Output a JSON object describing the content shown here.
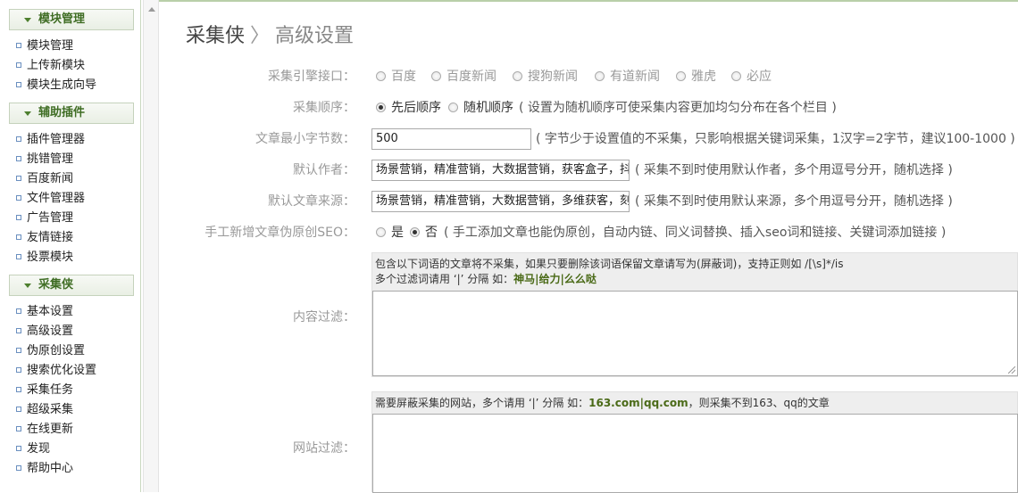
{
  "sidebar": {
    "groups": [
      {
        "title": "模块管理",
        "items": [
          "模块管理",
          "上传新模块",
          "模块生成向导"
        ]
      },
      {
        "title": "辅助插件",
        "items": [
          "插件管理器",
          "挑错管理",
          "百度新闻",
          "文件管理器",
          "广告管理",
          "友情链接",
          "投票模块"
        ]
      },
      {
        "title": "采集侠",
        "items": [
          "基本设置",
          "高级设置",
          "伪原创设置",
          "搜索优化设置",
          "采集任务",
          "超级采集",
          "在线更新",
          "发现",
          "帮助中心"
        ]
      }
    ]
  },
  "header": {
    "title": "采集侠",
    "separator": "〉",
    "subtitle": "高级设置"
  },
  "form": {
    "engine": {
      "label": "采集引擎接口：",
      "options": [
        "百度",
        "百度新闻",
        "搜狗新闻",
        "有道新闻",
        "雅虎",
        "必应"
      ]
    },
    "order": {
      "label": "采集顺序：",
      "options": [
        "先后顺序",
        "随机顺序"
      ],
      "selected": "先后顺序",
      "hint": "( 设置为随机顺序可使采集内容更加均匀分布在各个栏目 )"
    },
    "min_bytes": {
      "label": "文章最小字节数：",
      "value": "500",
      "hint": "( 字节少于设置值的不采集，只影响根据关键词采集，1汉字=2字节，建议100-1000 )"
    },
    "author": {
      "label": "默认作者：",
      "value": "场景营销，精准营销，大数据营销，获客盒子，抖",
      "hint": "( 采集不到时使用默认作者，多个用逗号分开，随机选择 )"
    },
    "source": {
      "label": "默认文章来源：",
      "value": "场景营销，精准营销，大数据营销，多维获客，刻",
      "hint": "( 采集不到时使用默认来源，多个用逗号分开，随机选择 )"
    },
    "seo": {
      "label": "手工新增文章伪原创SEO：",
      "options": [
        "是",
        "否"
      ],
      "selected": "否",
      "hint": "( 手工添加文章也能伪原创，自动内链、同义词替换、插入seo词和链接、关键词添加链接 )"
    },
    "content_filter": {
      "label": "内容过滤：",
      "desc_line1": "包含以下词语的文章将不采集，如果只要删除该词语保留文章请写为(屏蔽词)，支持正则如 /[\\s]*/is",
      "desc_line2_prefix": "多个过滤词请用 ‘|’ 分隔 如：",
      "desc_line2_example": "神马|给力|么么哒"
    },
    "site_filter": {
      "label": "网站过滤：",
      "desc_prefix": "需要屏蔽采集的网站，多个请用 ‘|’ 分隔 如：",
      "desc_example": "163.com|qq.com",
      "desc_suffix": "，则采集不到163、qq的文章"
    }
  },
  "colors": {
    "accent": "#3f6d24",
    "example": "#4a6a17"
  }
}
